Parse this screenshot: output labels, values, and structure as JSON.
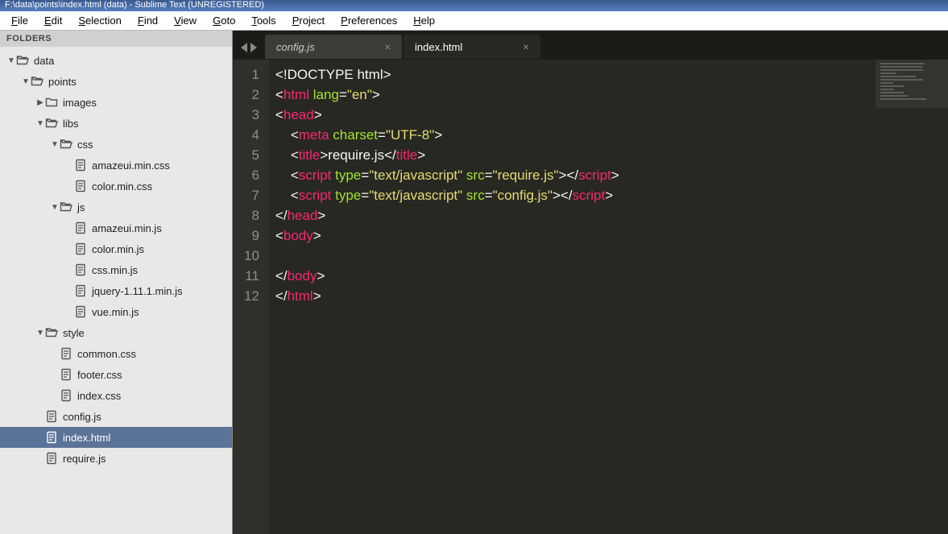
{
  "window": {
    "title": "F:\\data\\points\\index.html (data) - Sublime Text (UNREGISTERED)"
  },
  "menu": [
    "File",
    "Edit",
    "Selection",
    "Find",
    "View",
    "Goto",
    "Tools",
    "Project",
    "Preferences",
    "Help"
  ],
  "sidebar": {
    "header": "FOLDERS",
    "tree": [
      {
        "depth": 0,
        "kind": "folder-open",
        "arrow": "▼",
        "label": "data"
      },
      {
        "depth": 1,
        "kind": "folder-open",
        "arrow": "▼",
        "label": "points"
      },
      {
        "depth": 2,
        "kind": "folder",
        "arrow": "▶",
        "label": "images"
      },
      {
        "depth": 2,
        "kind": "folder-open",
        "arrow": "▼",
        "label": "libs"
      },
      {
        "depth": 3,
        "kind": "folder-open",
        "arrow": "▼",
        "label": "css"
      },
      {
        "depth": 4,
        "kind": "file",
        "arrow": "",
        "label": "amazeui.min.css"
      },
      {
        "depth": 4,
        "kind": "file",
        "arrow": "",
        "label": "color.min.css"
      },
      {
        "depth": 3,
        "kind": "folder-open",
        "arrow": "▼",
        "label": "js"
      },
      {
        "depth": 4,
        "kind": "file",
        "arrow": "",
        "label": "amazeui.min.js"
      },
      {
        "depth": 4,
        "kind": "file",
        "arrow": "",
        "label": "color.min.js"
      },
      {
        "depth": 4,
        "kind": "file",
        "arrow": "",
        "label": "css.min.js"
      },
      {
        "depth": 4,
        "kind": "file",
        "arrow": "",
        "label": "jquery-1.11.1.min.js"
      },
      {
        "depth": 4,
        "kind": "file",
        "arrow": "",
        "label": "vue.min.js"
      },
      {
        "depth": 2,
        "kind": "folder-open",
        "arrow": "▼",
        "label": "style"
      },
      {
        "depth": 3,
        "kind": "file",
        "arrow": "",
        "label": "common.css"
      },
      {
        "depth": 3,
        "kind": "file",
        "arrow": "",
        "label": "footer.css"
      },
      {
        "depth": 3,
        "kind": "file",
        "arrow": "",
        "label": "index.css"
      },
      {
        "depth": 2,
        "kind": "file",
        "arrow": "",
        "label": "config.js"
      },
      {
        "depth": 2,
        "kind": "file",
        "arrow": "",
        "label": "index.html",
        "selected": true
      },
      {
        "depth": 2,
        "kind": "file",
        "arrow": "",
        "label": "require.js"
      }
    ]
  },
  "tabs": [
    {
      "label": "config.js",
      "active": false
    },
    {
      "label": "index.html",
      "active": true
    }
  ],
  "code": {
    "line_numbers": [
      1,
      2,
      3,
      4,
      5,
      6,
      7,
      8,
      9,
      10,
      11,
      12
    ],
    "lines": [
      [
        {
          "t": "<!",
          "c": "punct"
        },
        {
          "t": "DOCTYPE html",
          "c": "doctype"
        },
        {
          "t": ">",
          "c": "punct"
        }
      ],
      [
        {
          "t": "<",
          "c": "punct"
        },
        {
          "t": "html",
          "c": "tag"
        },
        {
          "t": " ",
          "c": "text"
        },
        {
          "t": "lang",
          "c": "attr"
        },
        {
          "t": "=",
          "c": "punct"
        },
        {
          "t": "\"en\"",
          "c": "str"
        },
        {
          "t": ">",
          "c": "punct"
        }
      ],
      [
        {
          "t": "<",
          "c": "punct"
        },
        {
          "t": "head",
          "c": "tag"
        },
        {
          "t": ">",
          "c": "punct"
        }
      ],
      [
        {
          "t": "    <",
          "c": "punct"
        },
        {
          "t": "meta",
          "c": "tag"
        },
        {
          "t": " ",
          "c": "text"
        },
        {
          "t": "charset",
          "c": "attr"
        },
        {
          "t": "=",
          "c": "punct"
        },
        {
          "t": "\"UTF-8\"",
          "c": "str"
        },
        {
          "t": ">",
          "c": "punct"
        }
      ],
      [
        {
          "t": "    <",
          "c": "punct"
        },
        {
          "t": "title",
          "c": "tag"
        },
        {
          "t": ">",
          "c": "punct"
        },
        {
          "t": "require.js",
          "c": "text"
        },
        {
          "t": "</",
          "c": "punct"
        },
        {
          "t": "title",
          "c": "tag"
        },
        {
          "t": ">",
          "c": "punct"
        }
      ],
      [
        {
          "t": "    <",
          "c": "punct"
        },
        {
          "t": "script",
          "c": "tag"
        },
        {
          "t": " ",
          "c": "text"
        },
        {
          "t": "type",
          "c": "attr"
        },
        {
          "t": "=",
          "c": "punct"
        },
        {
          "t": "\"text/javascript\"",
          "c": "str"
        },
        {
          "t": " ",
          "c": "text"
        },
        {
          "t": "src",
          "c": "attr"
        },
        {
          "t": "=",
          "c": "punct"
        },
        {
          "t": "\"require.js\"",
          "c": "str"
        },
        {
          "t": "></",
          "c": "punct"
        },
        {
          "t": "script",
          "c": "tag"
        },
        {
          "t": ">",
          "c": "punct"
        }
      ],
      [
        {
          "t": "    <",
          "c": "punct"
        },
        {
          "t": "script",
          "c": "tag"
        },
        {
          "t": " ",
          "c": "text"
        },
        {
          "t": "type",
          "c": "attr"
        },
        {
          "t": "=",
          "c": "punct"
        },
        {
          "t": "\"text/javascript\"",
          "c": "str"
        },
        {
          "t": " ",
          "c": "text"
        },
        {
          "t": "src",
          "c": "attr"
        },
        {
          "t": "=",
          "c": "punct"
        },
        {
          "t": "\"config.js\"",
          "c": "str"
        },
        {
          "t": "></",
          "c": "punct"
        },
        {
          "t": "script",
          "c": "tag"
        },
        {
          "t": ">",
          "c": "punct"
        }
      ],
      [
        {
          "t": "</",
          "c": "punct"
        },
        {
          "t": "head",
          "c": "tag"
        },
        {
          "t": ">",
          "c": "punct"
        }
      ],
      [
        {
          "t": "<",
          "c": "punct"
        },
        {
          "t": "body",
          "c": "tag"
        },
        {
          "t": ">",
          "c": "punct"
        }
      ],
      [
        {
          "t": "",
          "c": "text"
        }
      ],
      [
        {
          "t": "</",
          "c": "punct"
        },
        {
          "t": "body",
          "c": "tag"
        },
        {
          "t": ">",
          "c": "punct"
        }
      ],
      [
        {
          "t": "</",
          "c": "punct"
        },
        {
          "t": "html",
          "c": "tag"
        },
        {
          "t": ">",
          "c": "punct"
        }
      ]
    ]
  }
}
